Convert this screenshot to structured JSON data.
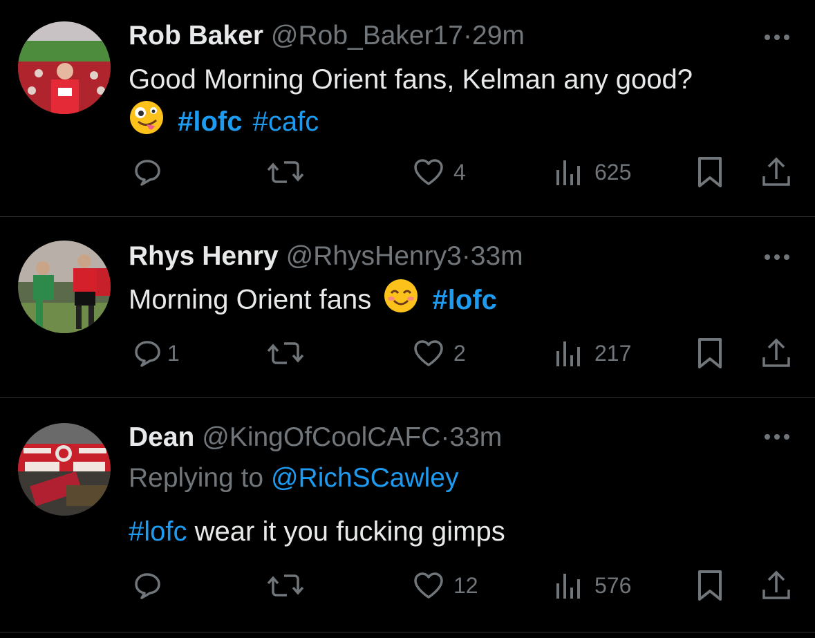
{
  "tweets": [
    {
      "name": "Rob Baker",
      "handle": "@Rob_Baker17",
      "separator": "·",
      "time": "29m",
      "text_line1": "Good Morning Orient fans, Kelman any good?",
      "emoji": "zany-face-emoji",
      "hashtags": [
        "#lofc",
        "#cafc"
      ],
      "replies": "",
      "likes": "4",
      "views": "625"
    },
    {
      "name": "Rhys Henry",
      "handle": "@RhysHenry3",
      "separator": "·",
      "time": "33m",
      "text": "Morning Orient fans",
      "emoji": "smiling-face-emoji",
      "hashtags": [
        "#lofc"
      ],
      "replies": "1",
      "likes": "2",
      "views": "217"
    },
    {
      "name": "Dean",
      "handle": "@KingOfCoolCAFC",
      "separator": "·",
      "time": "33m",
      "replying_prefix": "Replying to",
      "replying_to": "@RichSCawley",
      "hashtag": "#lofc",
      "text": "wear it you fucking gimps",
      "replies": "",
      "likes": "12",
      "views": "576"
    }
  ],
  "icons": {
    "reply": "reply-icon",
    "retweet": "retweet-icon",
    "like": "heart-icon",
    "views": "views-icon",
    "bookmark": "bookmark-icon",
    "share": "share-icon",
    "more": "more-icon"
  },
  "colors": {
    "background": "#000000",
    "text": "#e7e9ea",
    "muted": "#71767b",
    "link": "#1d9bf0",
    "divider": "#2f3336"
  }
}
